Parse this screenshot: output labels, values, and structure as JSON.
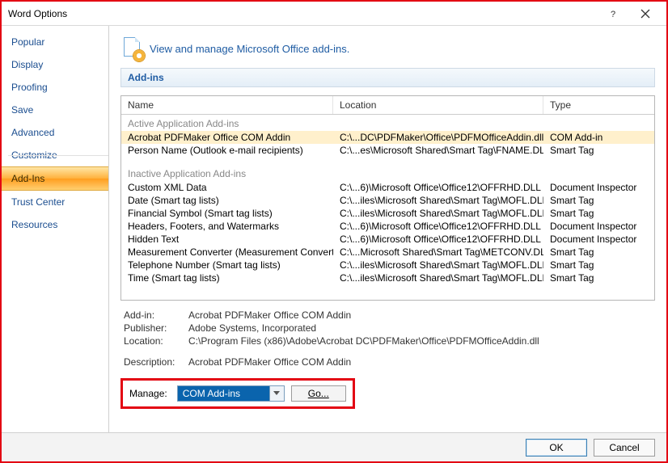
{
  "window": {
    "title": "Word Options"
  },
  "sidebar": {
    "items": [
      {
        "label": "Popular"
      },
      {
        "label": "Display"
      },
      {
        "label": "Proofing"
      },
      {
        "label": "Save"
      },
      {
        "label": "Advanced"
      },
      {
        "label": "Customize"
      },
      {
        "label": "Add-Ins"
      },
      {
        "label": "Trust Center"
      },
      {
        "label": "Resources"
      }
    ],
    "selected_index": 6
  },
  "header": {
    "text": "View and manage Microsoft Office add-ins."
  },
  "section": {
    "label": "Add-ins"
  },
  "columns": {
    "name": "Name",
    "location": "Location",
    "type": "Type"
  },
  "groups": {
    "active_label": "Active Application Add-ins",
    "inactive_label": "Inactive Application Add-ins"
  },
  "active": [
    {
      "name": "Acrobat PDFMaker Office COM Addin",
      "location": "C:\\...DC\\PDFMaker\\Office\\PDFMOfficeAddin.dll",
      "type": "COM Add-in"
    },
    {
      "name": "Person Name (Outlook e-mail recipients)",
      "location": "C:\\...es\\Microsoft Shared\\Smart Tag\\FNAME.DLL",
      "type": "Smart Tag"
    }
  ],
  "inactive": [
    {
      "name": "Custom XML Data",
      "location": "C:\\...6)\\Microsoft Office\\Office12\\OFFRHD.DLL",
      "type": "Document Inspector"
    },
    {
      "name": "Date (Smart tag lists)",
      "location": "C:\\...iles\\Microsoft Shared\\Smart Tag\\MOFL.DLL",
      "type": "Smart Tag"
    },
    {
      "name": "Financial Symbol (Smart tag lists)",
      "location": "C:\\...iles\\Microsoft Shared\\Smart Tag\\MOFL.DLL",
      "type": "Smart Tag"
    },
    {
      "name": "Headers, Footers, and Watermarks",
      "location": "C:\\...6)\\Microsoft Office\\Office12\\OFFRHD.DLL",
      "type": "Document Inspector"
    },
    {
      "name": "Hidden Text",
      "location": "C:\\...6)\\Microsoft Office\\Office12\\OFFRHD.DLL",
      "type": "Document Inspector"
    },
    {
      "name": "Measurement Converter (Measurement Converter)",
      "location": "C:\\...Microsoft Shared\\Smart Tag\\METCONV.DLL",
      "type": "Smart Tag"
    },
    {
      "name": "Telephone Number (Smart tag lists)",
      "location": "C:\\...iles\\Microsoft Shared\\Smart Tag\\MOFL.DLL",
      "type": "Smart Tag"
    },
    {
      "name": "Time (Smart tag lists)",
      "location": "C:\\...iles\\Microsoft Shared\\Smart Tag\\MOFL.DLL",
      "type": "Smart Tag"
    }
  ],
  "details": {
    "labels": {
      "addin": "Add-in:",
      "publisher": "Publisher:",
      "location": "Location:",
      "description": "Description:"
    },
    "addin": "Acrobat PDFMaker Office COM Addin",
    "publisher": "Adobe Systems, Incorporated",
    "location": "C:\\Program Files (x86)\\Adobe\\Acrobat DC\\PDFMaker\\Office\\PDFMOfficeAddin.dll",
    "description": "Acrobat PDFMaker Office COM Addin"
  },
  "manage": {
    "label": "Manage:",
    "selected": "COM Add-ins",
    "go": "Go..."
  },
  "footer": {
    "ok": "OK",
    "cancel": "Cancel"
  }
}
